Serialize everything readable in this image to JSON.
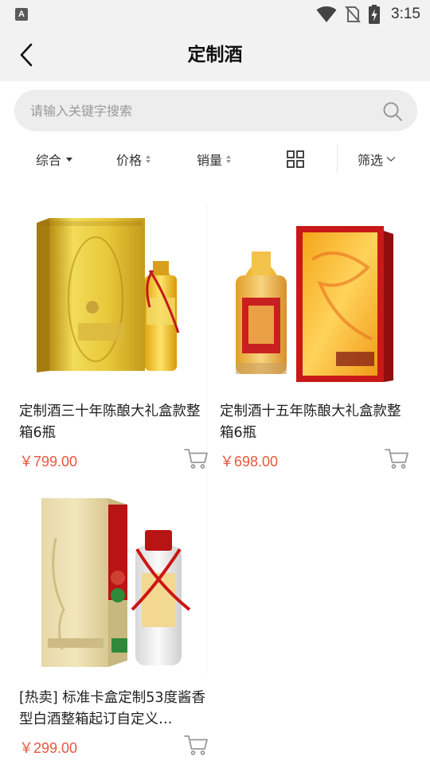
{
  "status": {
    "app_badge": "A",
    "time": "3:15"
  },
  "header": {
    "title": "定制酒"
  },
  "search": {
    "placeholder": "请输入关键字搜索"
  },
  "filters": {
    "comprehensive": "综合",
    "price": "价格",
    "sales": "销量",
    "filter": "筛选"
  },
  "products": [
    {
      "name": "定制酒三十年陈酿大礼盒款整箱6瓶",
      "price": "￥799.00"
    },
    {
      "name": "定制酒十五年陈酿大礼盒款整箱6瓶",
      "price": "￥698.00"
    },
    {
      "name": "[热卖] 标准卡盒定制53度酱香型白酒整箱起订自定义…",
      "price": "￥299.00"
    }
  ],
  "colors": {
    "price": "#e8563f",
    "header_bg": "#f2f2f2"
  }
}
